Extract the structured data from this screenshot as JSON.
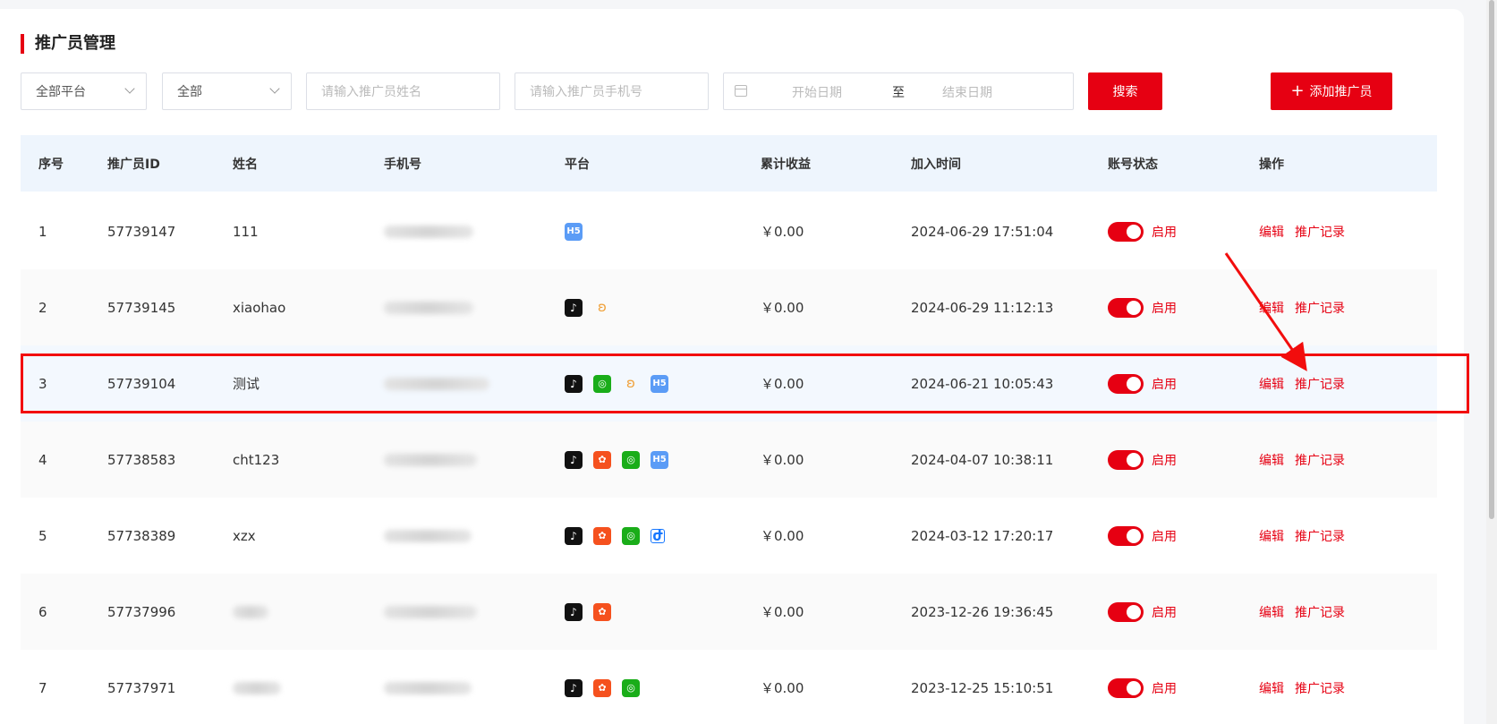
{
  "page": {
    "title": "推广员管理"
  },
  "filters": {
    "platform_select": "全部平台",
    "status_select": "全部",
    "name_placeholder": "请输入推广员姓名",
    "phone_placeholder": "请输入推广员手机号",
    "start_date_placeholder": "开始日期",
    "date_separator": "至",
    "end_date_placeholder": "结束日期",
    "search_label": "搜索",
    "add_label": "添加推广员",
    "add_icon": "+"
  },
  "table": {
    "headers": [
      "序号",
      "推广员ID",
      "姓名",
      "手机号",
      "平台",
      "累计收益",
      "加入时间",
      "账号状态",
      "操作"
    ],
    "rows": [
      {
        "no": "1",
        "id": "57739147",
        "name": "111",
        "platforms": [
          "h5"
        ],
        "income": "￥0.00",
        "joined": "2024-06-29 17:51:04",
        "status": "启用",
        "edit": "编辑",
        "record": "推广记录"
      },
      {
        "no": "2",
        "id": "57739145",
        "name": "xiaohao",
        "platforms": [
          "tiktok",
          "mini"
        ],
        "income": "￥0.00",
        "joined": "2024-06-29 11:12:13",
        "status": "启用",
        "edit": "编辑",
        "record": "推广记录"
      },
      {
        "no": "3",
        "id": "57739104",
        "name": "测试",
        "platforms": [
          "tiktok",
          "wechat",
          "mini",
          "h5"
        ],
        "income": "￥0.00",
        "joined": "2024-06-21 10:05:43",
        "status": "启用",
        "edit": "编辑",
        "record": "推广记录"
      },
      {
        "no": "4",
        "id": "57738583",
        "name": "cht123",
        "platforms": [
          "tiktok",
          "kuai",
          "wechat",
          "h5"
        ],
        "income": "￥0.00",
        "joined": "2024-04-07 10:38:11",
        "status": "启用",
        "edit": "编辑",
        "record": "推广记录"
      },
      {
        "no": "5",
        "id": "57738389",
        "name": "xzx",
        "platforms": [
          "tiktok",
          "kuai",
          "wechat",
          "pay"
        ],
        "income": "￥0.00",
        "joined": "2024-03-12 17:20:17",
        "status": "启用",
        "edit": "编辑",
        "record": "推广记录"
      },
      {
        "no": "6",
        "id": "57737996",
        "name": "",
        "platforms": [
          "tiktok",
          "kuai"
        ],
        "income": "￥0.00",
        "joined": "2023-12-26 19:36:45",
        "status": "启用",
        "edit": "编辑",
        "record": "推广记录"
      },
      {
        "no": "7",
        "id": "57737971",
        "name": "",
        "platforms": [
          "tiktok",
          "kuai",
          "wechat"
        ],
        "income": "￥0.00",
        "joined": "2023-12-25 15:10:51",
        "status": "启用",
        "edit": "编辑",
        "record": "推广记录"
      }
    ]
  },
  "icons": {
    "h5": "H5",
    "tiktok": "♪",
    "wechat": "◎",
    "kuai": "✿",
    "mini": "ʚ",
    "pay": "ժ"
  },
  "colors": {
    "accent": "#e60012",
    "header_bg": "#eef5fd",
    "h5": "#5b9cf6",
    "wechat": "#1aad19",
    "kuai": "#f5511e"
  }
}
